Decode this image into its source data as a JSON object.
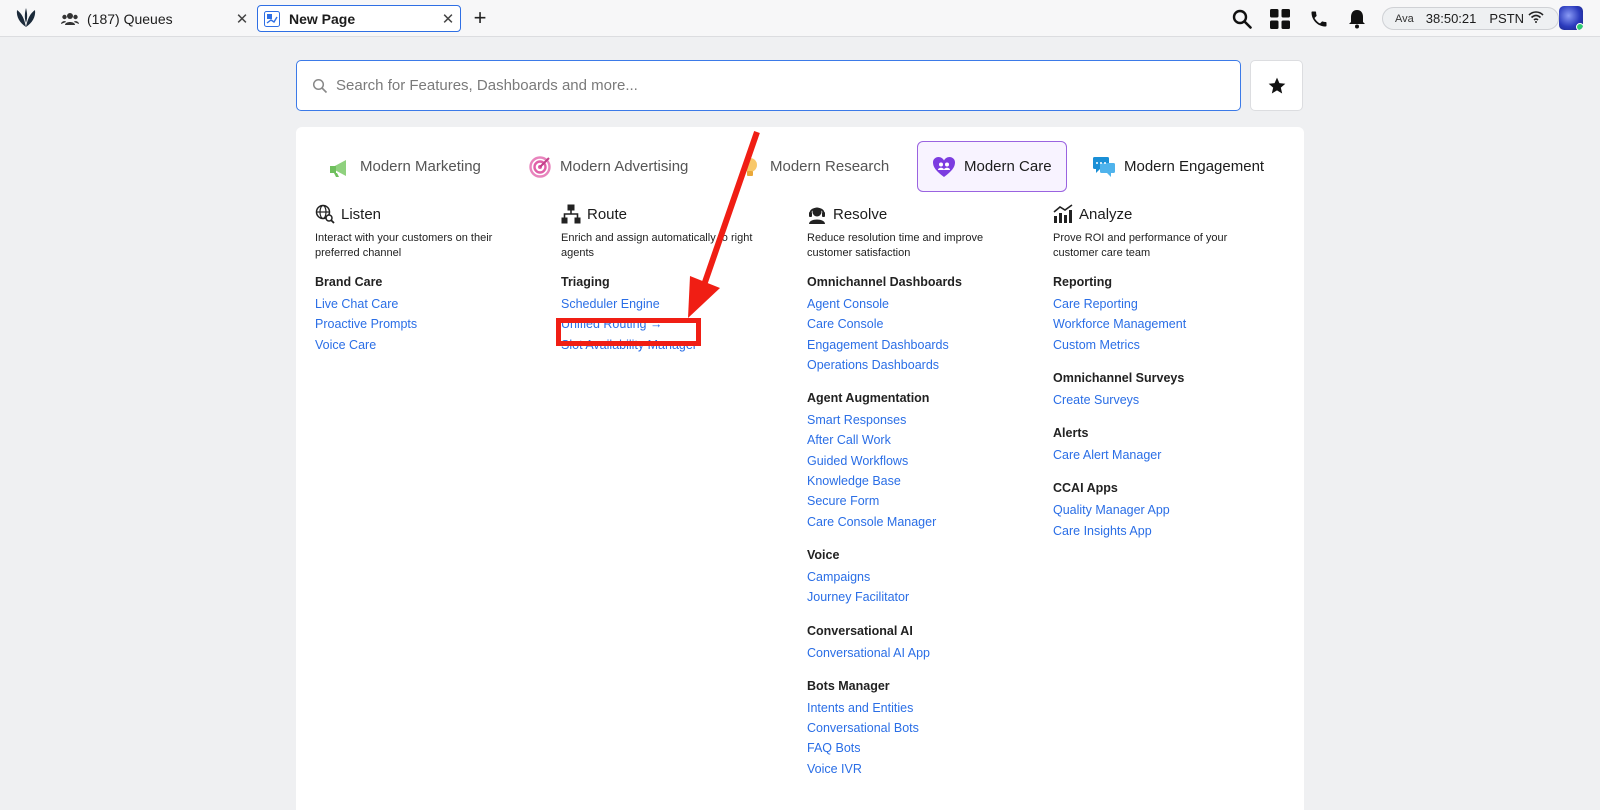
{
  "tabs": [
    {
      "label": "(187) Queues",
      "icon": "people-icon",
      "active": false
    },
    {
      "label": "New Page",
      "icon": "page-icon",
      "active": true
    }
  ],
  "status": {
    "agent": "Ava",
    "timer": "38:50:21",
    "line": "PSTN"
  },
  "search": {
    "placeholder": "Search for Features, Dashboards and more..."
  },
  "categories": [
    {
      "label": "Modern Marketing",
      "icon": "megaphone-icon",
      "color": "#7cc96b"
    },
    {
      "label": "Modern Advertising",
      "icon": "target-icon",
      "color": "#e060a8"
    },
    {
      "label": "Modern Research",
      "icon": "bulb-icon",
      "color": "#f5b84c"
    },
    {
      "label": "Modern Care",
      "icon": "heart-icon",
      "color": "#7c3ce0",
      "active": true
    },
    {
      "label": "Modern Engagement",
      "icon": "chat-icon",
      "color": "#1a8fd6"
    }
  ],
  "columns": [
    {
      "title": "Listen",
      "icon": "globe-search-icon",
      "desc": "Interact with your customers on their preferred channel",
      "sections": [
        {
          "title": "Brand Care",
          "links": [
            "Live Chat Care",
            "Proactive Prompts",
            "Voice Care"
          ]
        }
      ]
    },
    {
      "title": "Route",
      "icon": "hierarchy-icon",
      "desc": "Enrich and assign automatically to right agents",
      "sections": [
        {
          "title": "Triaging",
          "links": [
            "Scheduler Engine",
            "Unified Routing →",
            "Slot Availability Manager"
          ]
        }
      ]
    },
    {
      "title": "Resolve",
      "icon": "headset-icon",
      "desc": "Reduce resolution time and improve customer satisfaction",
      "sections": [
        {
          "title": "Omnichannel Dashboards",
          "links": [
            "Agent Console",
            "Care Console",
            "Engagement Dashboards",
            "Operations Dashboards"
          ]
        },
        {
          "title": "Agent Augmentation",
          "links": [
            "Smart Responses",
            "After Call Work",
            "Guided Workflows",
            "Knowledge Base",
            "Secure Form",
            "Care Console Manager"
          ]
        },
        {
          "title": "Voice",
          "links": [
            "Campaigns",
            "Journey Facilitator"
          ]
        },
        {
          "title": "Conversational AI",
          "links": [
            "Conversational AI App"
          ]
        },
        {
          "title": "Bots Manager",
          "links": [
            "Intents and Entities",
            "Conversational Bots",
            "FAQ Bots",
            "Voice IVR"
          ]
        }
      ]
    },
    {
      "title": "Analyze",
      "icon": "chart-icon",
      "desc": "Prove ROI and performance of your customer care team",
      "sections": [
        {
          "title": "Reporting",
          "links": [
            "Care Reporting",
            "Workforce Management",
            "Custom Metrics"
          ]
        },
        {
          "title": "Omnichannel Surveys",
          "links": [
            "Create Surveys"
          ]
        },
        {
          "title": "Alerts",
          "links": [
            "Care Alert Manager"
          ]
        },
        {
          "title": "CCAI Apps",
          "links": [
            "Quality Manager App",
            "Care Insights App"
          ]
        }
      ]
    }
  ],
  "annotation": {
    "color": "#f01e14",
    "target": "Unified Routing →"
  }
}
